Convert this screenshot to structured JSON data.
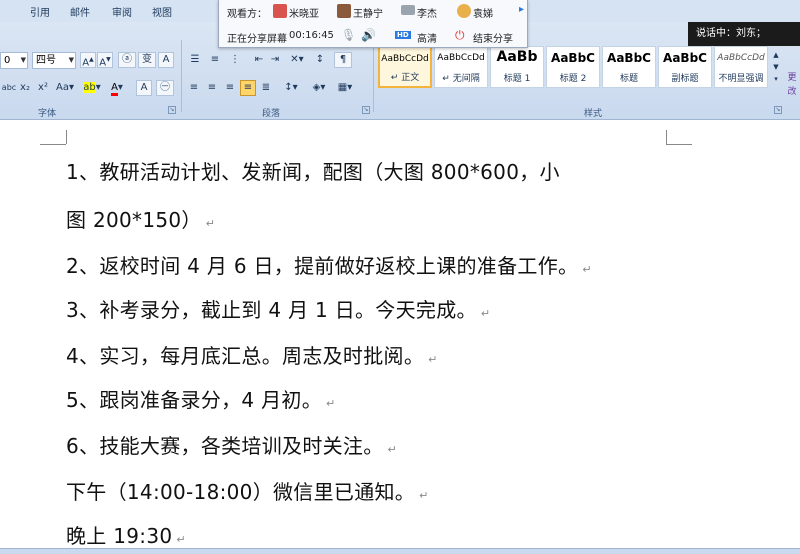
{
  "ribbon": {
    "tabs": [
      "引用",
      "邮件",
      "审阅",
      "视图"
    ],
    "font_group": {
      "size_value": "四号",
      "left_size_value": "0",
      "label": "字体"
    },
    "paragraph_group": {
      "label": "段落"
    },
    "styles_group": {
      "label": "样式",
      "tiles": [
        {
          "sample": "AaBbCcDd",
          "name": "↵ 正文",
          "selected": true
        },
        {
          "sample": "AaBbCcDd",
          "name": "↵ 无间隔",
          "selected": false
        },
        {
          "sample": "AaBb",
          "name": "标题 1",
          "selected": false
        },
        {
          "sample": "AaBbC",
          "name": "标题 2",
          "selected": false
        },
        {
          "sample": "AaBbC",
          "name": "标题",
          "selected": false
        },
        {
          "sample": "AaBbC",
          "name": "副标题",
          "selected": false
        },
        {
          "sample": "AaBbCcDd",
          "name": "不明显强调",
          "selected": false
        }
      ],
      "more_label": "更改"
    }
  },
  "share_bar": {
    "viewers_label": "观看方：",
    "viewers": [
      "米晓亚",
      "王静宁",
      "李杰",
      "袁娣"
    ],
    "status": "正在分享屏幕",
    "elapsed": "00:16:45",
    "hd_badge": "HD",
    "hd_label": "高清",
    "end_label": "结束分享"
  },
  "speaking": {
    "label": "说话中：刘东；"
  },
  "document": {
    "lines": [
      "1、教研活动计划、发新闻，配图（大图 800*600，小",
      "图 200*150）",
      "2、返校时间 4 月 6 日，提前做好返校上课的准备工作。",
      "3、补考录分，截止到 4 月 1 日。今天完成。",
      "4、实习，每月底汇总。周志及时批阅。",
      "5、跟岗准备录分，4 月初。",
      "6、技能大赛，各类培训及时关注。",
      "下午（14:00-18:00）微信里已通知。",
      "晚上 19:30"
    ],
    "para_mark": "↵"
  },
  "colors": {
    "accent": "#f3b33d",
    "ribbon": "#dfe9f5",
    "highlight_color": "#ffff00",
    "font_color": "#ff0000"
  }
}
